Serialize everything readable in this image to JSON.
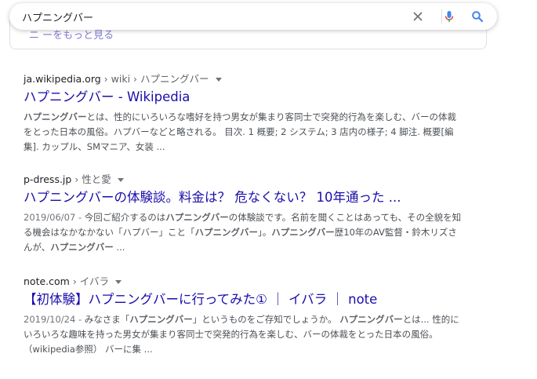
{
  "search": {
    "query": "ハプニングバー"
  },
  "prev_card": {
    "peek_text": "ニ ーをもっと見る"
  },
  "results": [
    {
      "site": "ja.wikipedia.org",
      "path": " › wiki › ハプニングバー",
      "title": "ハプニングバー - Wikipedia",
      "date": "",
      "snippet": [
        {
          "b": "ハプニングバー"
        },
        {
          "t": "とは、性的にいろいろな嗜好を持つ男女が集まり客同士で突発的行為を楽しむ、バーの体裁をとった日本の風俗。ハプバーなどと略される。 目次. 1 概要; 2 システム; 3 店内の様子; 4 脚注. 概要[編集]. カップル、SMマニア、女装 ..."
        }
      ]
    },
    {
      "site": "p-dress.jp",
      "path": " › 性と愛",
      "title": "ハプニングバーの体験談。料金は？ 危なくない？ 10年通った ...",
      "date": "2019/06/07 - ",
      "snippet": [
        {
          "t": "今回ご紹介するのは"
        },
        {
          "b": "ハプニングバー"
        },
        {
          "t": "の体験談です。名前を聞くことはあっても、その全貌を知る機会はなかなかない「ハプバー」こと「"
        },
        {
          "b": "ハプニングバー"
        },
        {
          "t": "」。"
        },
        {
          "b": "ハプニングバー"
        },
        {
          "t": "歴10年のAV監督・鈴木リズさんが、"
        },
        {
          "b": "ハプニングバー"
        },
        {
          "t": " ..."
        }
      ]
    },
    {
      "site": "note.com",
      "path": " › イバラ",
      "title": "【初体験】ハプニングバーに行ってみた① ｜ イバラ ｜ note",
      "date": "2019/10/24 - ",
      "snippet": [
        {
          "t": "みなさま「"
        },
        {
          "b": "ハプニングバー"
        },
        {
          "t": "」というものをご存知でしょうか。 "
        },
        {
          "b": "ハプニングバー"
        },
        {
          "t": "とは... 性的にいろいろな趣味を持った男女が集まり客同士で突発的行為を楽しむ、バーの体裁をとった日本の風俗。（wikipedia参照） バーに集 ..."
        }
      ]
    }
  ],
  "colors": {
    "link": "#1a0dab",
    "snippet": "#4d5156",
    "mic_blue": "#4285f4",
    "mic_red": "#ea4335",
    "search_blue": "#4285f4"
  },
  "icons": {
    "clear": "close-icon",
    "voice": "microphone-icon",
    "search": "search-icon",
    "result_menu": "caret-down-icon"
  }
}
